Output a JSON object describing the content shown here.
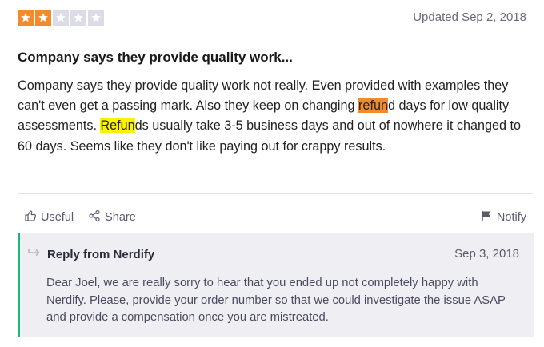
{
  "rating": {
    "value": 2,
    "max": 5,
    "filled_color": "#f48b2a",
    "empty_color": "#dcdce6",
    "icon": "star-icon"
  },
  "review": {
    "updated": "Updated Sep 2, 2018",
    "title": "Company says they provide quality work...",
    "body": {
      "part1": "Company says they provide quality work not really. Even provided with examples they can't even get a passing mark. Also they keep on changing ",
      "hl1": "refun",
      "part2": "d days for low quality assessments. ",
      "hl2": "Refun",
      "part3": "ds usually take 3-5 business days and out of nowhere it changed to 60 days. Seems like they don't like paying out for crappy results."
    }
  },
  "actions": {
    "useful": "Useful",
    "share": "Share",
    "notify": "Notify"
  },
  "reply": {
    "from": "Reply from Nerdify",
    "date": "Sep 3, 2018",
    "text": "Dear Joel, we are really sorry to hear that you ended up not completely happy with Nerdify. Please, provide your order number so that we could investigate the issue ASAP and provide a compensation once you are mistreated.",
    "accent_color": "#1ab67a"
  }
}
